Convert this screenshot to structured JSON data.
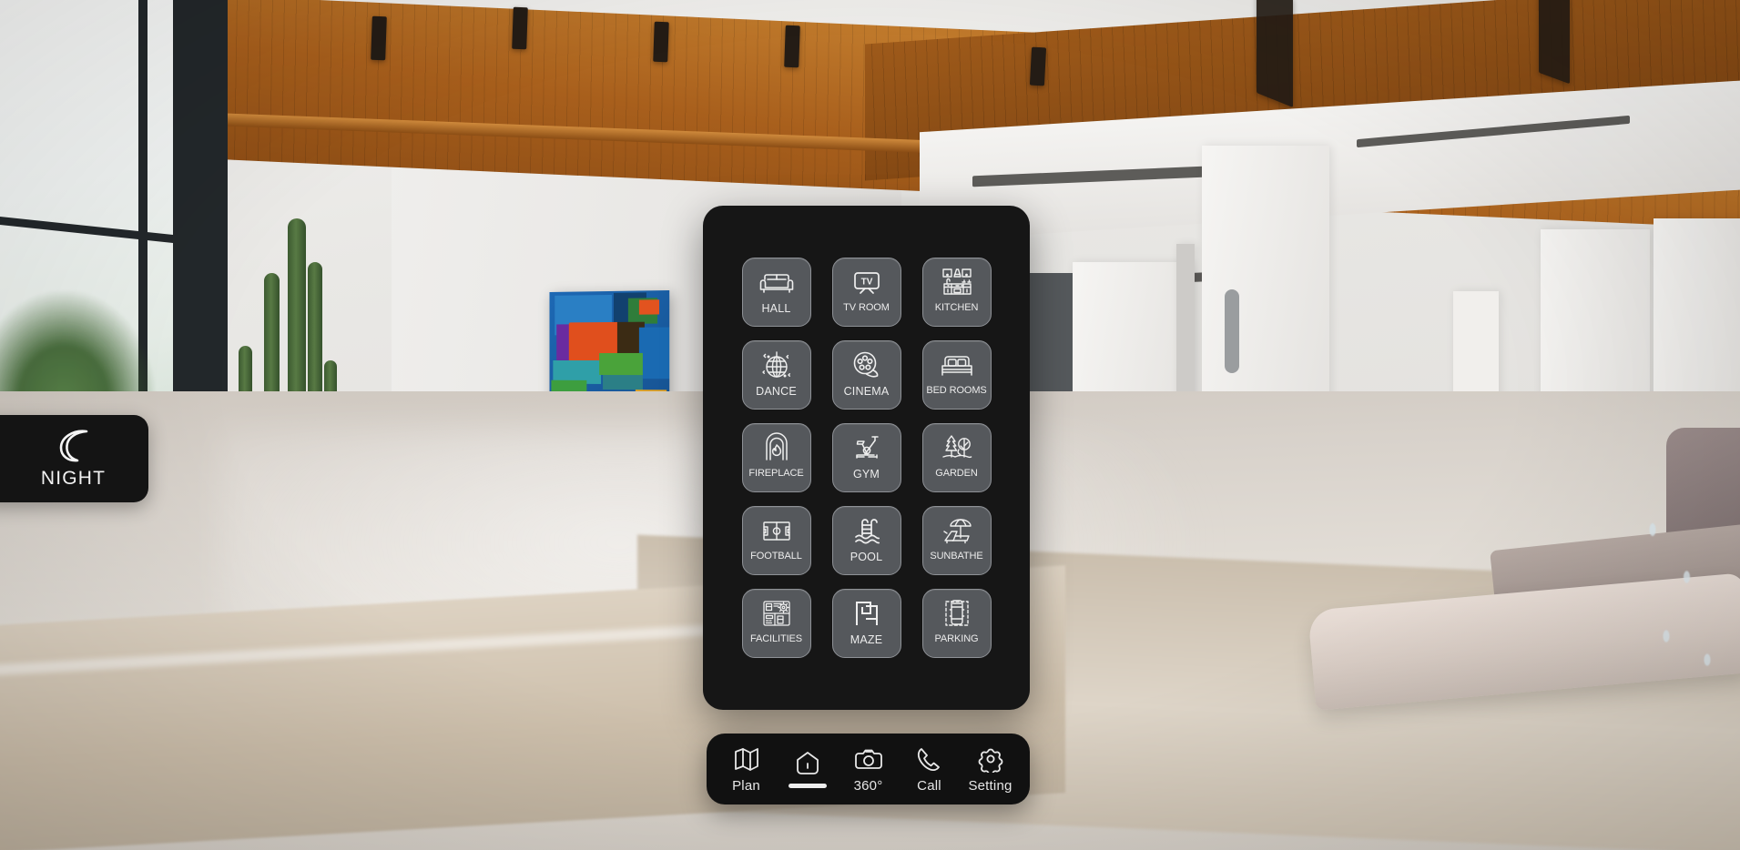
{
  "scene": {
    "description": "360 degree virtual tour of a modern living room with wood plank ceiling, white walls, large window, cactus plant, abstract painting and navy sofa"
  },
  "night_badge": {
    "label": "NIGHT",
    "icon": "moon-icon",
    "background": "#141414",
    "text_color": "#f2f2f2"
  },
  "room_menu": {
    "background": "#161616",
    "tile_background": "#55585c",
    "tile_border": "#8e9196",
    "tiles": [
      {
        "label": "HALL",
        "icon": "sofa-icon"
      },
      {
        "label": "TV ROOM",
        "icon": "television-icon"
      },
      {
        "label": "KITCHEN",
        "icon": "kitchen-cabinets-icon"
      },
      {
        "label": "DANCE",
        "icon": "disco-ball-icon"
      },
      {
        "label": "CINEMA",
        "icon": "film-reel-icon"
      },
      {
        "label": "BED ROOMS",
        "icon": "bed-icon"
      },
      {
        "label": "FIREPLACE",
        "icon": "fireplace-icon"
      },
      {
        "label": "GYM",
        "icon": "exercise-bike-icon"
      },
      {
        "label": "GARDEN",
        "icon": "trees-icon"
      },
      {
        "label": "FOOTBALL",
        "icon": "football-pitch-icon"
      },
      {
        "label": "POOL",
        "icon": "pool-ladder-icon"
      },
      {
        "label": "SUNBATHE",
        "icon": "sun-lounger-icon"
      },
      {
        "label": "FACILITIES",
        "icon": "blueprint-gear-icon"
      },
      {
        "label": "MAZE",
        "icon": "maze-icon"
      },
      {
        "label": "PARKING",
        "icon": "parked-car-icon"
      }
    ]
  },
  "toolbar": {
    "background": "#111111",
    "items": [
      {
        "label": "Plan",
        "icon": "map-icon",
        "type": "text"
      },
      {
        "label": "",
        "icon": "home-icon",
        "type": "indicator"
      },
      {
        "label": "360°",
        "icon": "camera-icon",
        "type": "text"
      },
      {
        "label": "Call",
        "icon": "phone-icon",
        "type": "text"
      },
      {
        "label": "Setting",
        "icon": "gear-icon",
        "type": "text"
      }
    ]
  }
}
